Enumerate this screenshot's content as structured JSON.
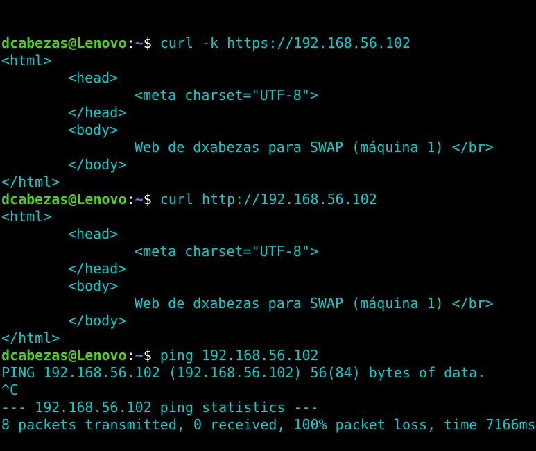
{
  "colors": {
    "background": "#000000",
    "text": "#00d0d0",
    "prompt_user": "#4fd11a",
    "prompt_path": "#4a86e0"
  },
  "prompt": {
    "user_host": "dcabezas@Lenovo",
    "colon": ":",
    "path": "~",
    "dollar": "$ "
  },
  "lines": [
    {
      "type": "prompt",
      "command": "curl -k https://192.168.56.102"
    },
    {
      "type": "output",
      "indent": 0,
      "text": "<html>"
    },
    {
      "type": "output",
      "indent": 1,
      "text": "<head>"
    },
    {
      "type": "output",
      "indent": 2,
      "text": "<meta charset=\"UTF-8\">"
    },
    {
      "type": "output",
      "indent": 1,
      "text": "</head>"
    },
    {
      "type": "output",
      "indent": 1,
      "text": "<body>"
    },
    {
      "type": "output",
      "indent": 2,
      "text": "Web de dxabezas para SWAP (máquina 1) </br>"
    },
    {
      "type": "output",
      "indent": 1,
      "text": "</body>"
    },
    {
      "type": "output",
      "indent": 0,
      "text": "</html>"
    },
    {
      "type": "prompt",
      "command": "curl http://192.168.56.102"
    },
    {
      "type": "output",
      "indent": 0,
      "text": "<html>"
    },
    {
      "type": "output",
      "indent": 1,
      "text": "<head>"
    },
    {
      "type": "output",
      "indent": 2,
      "text": "<meta charset=\"UTF-8\">"
    },
    {
      "type": "output",
      "indent": 1,
      "text": "</head>"
    },
    {
      "type": "output",
      "indent": 1,
      "text": "<body>"
    },
    {
      "type": "output",
      "indent": 2,
      "text": "Web de dxabezas para SWAP (máquina 1) </br>"
    },
    {
      "type": "output",
      "indent": 1,
      "text": "</body>"
    },
    {
      "type": "output",
      "indent": 0,
      "text": "</html>"
    },
    {
      "type": "prompt",
      "command": "ping 192.168.56.102"
    },
    {
      "type": "output",
      "indent": 0,
      "text": "PING 192.168.56.102 (192.168.56.102) 56(84) bytes of data."
    },
    {
      "type": "output",
      "indent": 0,
      "text": "^C"
    },
    {
      "type": "output",
      "indent": 0,
      "text": "--- 192.168.56.102 ping statistics ---"
    },
    {
      "type": "output",
      "indent": 0,
      "text": "8 packets transmitted, 0 received, 100% packet loss, time 7166ms"
    }
  ]
}
